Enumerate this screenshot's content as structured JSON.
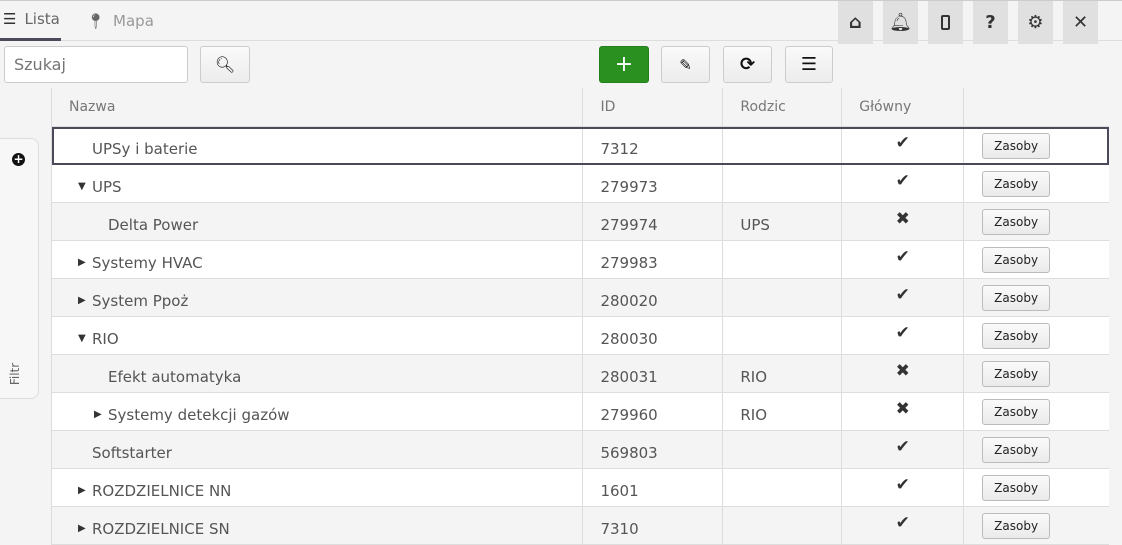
{
  "tabs": [
    {
      "label": "Lista",
      "icon": "list-icon"
    },
    {
      "label": "Mapa",
      "icon": "map-marker-icon"
    }
  ],
  "top_icons": [
    "home-icon",
    "bell-icon",
    "mobile-icon",
    "help-icon",
    "gear-icon",
    "close-icon"
  ],
  "search": {
    "placeholder": "Szukaj"
  },
  "filter": {
    "label": "Filtr"
  },
  "columns": [
    "Nazwa",
    "ID",
    "Rodzic",
    "Główny",
    ""
  ],
  "rows": [
    {
      "name": "UPSy i baterie",
      "id": "7312",
      "parent": "",
      "main": true,
      "level": 0,
      "expander": "none",
      "selected": true
    },
    {
      "name": "UPS",
      "id": "279973",
      "parent": "",
      "main": true,
      "level": 0,
      "expander": "expanded"
    },
    {
      "name": "Delta Power",
      "id": "279974",
      "parent": "UPS",
      "main": false,
      "level": 1,
      "expander": "none"
    },
    {
      "name": "Systemy HVAC",
      "id": "279983",
      "parent": "",
      "main": true,
      "level": 0,
      "expander": "collapsed"
    },
    {
      "name": "System Ppoż",
      "id": "280020",
      "parent": "",
      "main": true,
      "level": 0,
      "expander": "collapsed"
    },
    {
      "name": "RIO",
      "id": "280030",
      "parent": "",
      "main": true,
      "level": 0,
      "expander": "expanded"
    },
    {
      "name": "Efekt automatyka",
      "id": "280031",
      "parent": "RIO",
      "main": false,
      "level": 1,
      "expander": "none"
    },
    {
      "name": "Systemy detekcji gazów",
      "id": "279960",
      "parent": "RIO",
      "main": false,
      "level": 1,
      "expander": "collapsed"
    },
    {
      "name": "Softstarter",
      "id": "569803",
      "parent": "",
      "main": true,
      "level": 0,
      "expander": "none"
    },
    {
      "name": "ROZDZIELNICE NN",
      "id": "1601",
      "parent": "",
      "main": true,
      "level": 0,
      "expander": "collapsed"
    },
    {
      "name": "ROZDZIELNICE SN",
      "id": "7310",
      "parent": "",
      "main": true,
      "level": 0,
      "expander": "collapsed"
    }
  ],
  "row_button_label": "Zasoby",
  "colors": {
    "accent": "#2a9120",
    "selected_border": "#4a4a5a"
  }
}
